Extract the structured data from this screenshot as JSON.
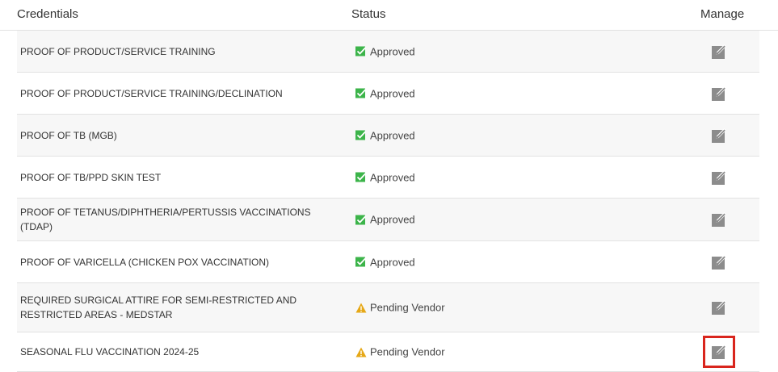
{
  "headers": {
    "credentials": "Credentials",
    "status": "Status",
    "manage": "Manage"
  },
  "rows": [
    {
      "credential": "PROOF OF PRODUCT/SERVICE TRAINING",
      "status": "Approved",
      "status_icon": "check-icon"
    },
    {
      "credential": "PROOF OF PRODUCT/SERVICE TRAINING/DECLINATION",
      "status": "Approved",
      "status_icon": "check-icon"
    },
    {
      "credential": "PROOF OF TB (MGB)",
      "status": "Approved",
      "status_icon": "check-icon"
    },
    {
      "credential": "PROOF OF TB/PPD SKIN TEST",
      "status": "Approved",
      "status_icon": "check-icon"
    },
    {
      "credential": "PROOF OF TETANUS/DIPHTHERIA/PERTUSSIS VACCINATIONS (TDAP)",
      "status": "Approved",
      "status_icon": "check-icon"
    },
    {
      "credential": "PROOF OF VARICELLA (CHICKEN POX VACCINATION)",
      "status": "Approved",
      "status_icon": "check-icon"
    },
    {
      "credential": "REQUIRED SURGICAL ATTIRE FOR SEMI-RESTRICTED AND RESTRICTED AREAS - MEDSTAR",
      "status": "Pending Vendor",
      "status_icon": "warning-icon"
    },
    {
      "credential": "SEASONAL FLU VACCINATION 2024-25",
      "status": "Pending Vendor",
      "status_icon": "warning-icon",
      "highlighted": true
    }
  ],
  "colors": {
    "approved": "#3cb44a",
    "pending": "#e6a817",
    "manage_icon": "#8c8c8c",
    "highlight": "#d9251d"
  }
}
